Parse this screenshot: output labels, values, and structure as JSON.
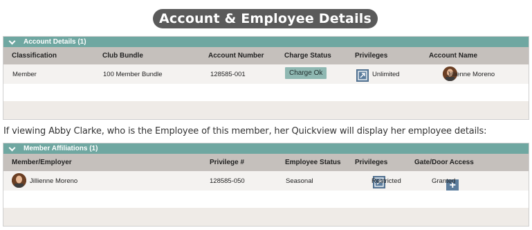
{
  "page_title": "Account & Employee Details",
  "account_panel": {
    "header": "Account Details (1)",
    "columns": [
      "Classification",
      "Club Bundle",
      "Account Number",
      "Charge Status",
      "Privileges",
      "Account Name"
    ],
    "row": {
      "classification": "Member",
      "club_bundle": "100 Member Bundle",
      "account_number": "128585-001",
      "charge_status": "Charge Ok",
      "privileges": "Unlimited",
      "account_name": "Jillienne Moreno"
    }
  },
  "caption": "If viewing Abby Clarke, who is the Employee of this member, her Quickview will display her employee details:",
  "affiliations_panel": {
    "header": "Member Affiliations (1)",
    "columns": [
      "Member/Employer",
      "Privilege #",
      "Employee Status",
      "Privileges",
      "Gate/Door Access"
    ],
    "row": {
      "member_employer": "Jillienne Moreno",
      "privilege_number": "128585-050",
      "employee_status": "Seasonal",
      "privileges": "Restricted",
      "gate_access": "Granted"
    }
  },
  "colors": {
    "panel_header": "#6fa7a1",
    "column_header": "#c5c0bc",
    "badge_ok": "#8fb8b2",
    "icon_blue": "#5b7c9c",
    "title_pill": "#5a5a5a"
  }
}
